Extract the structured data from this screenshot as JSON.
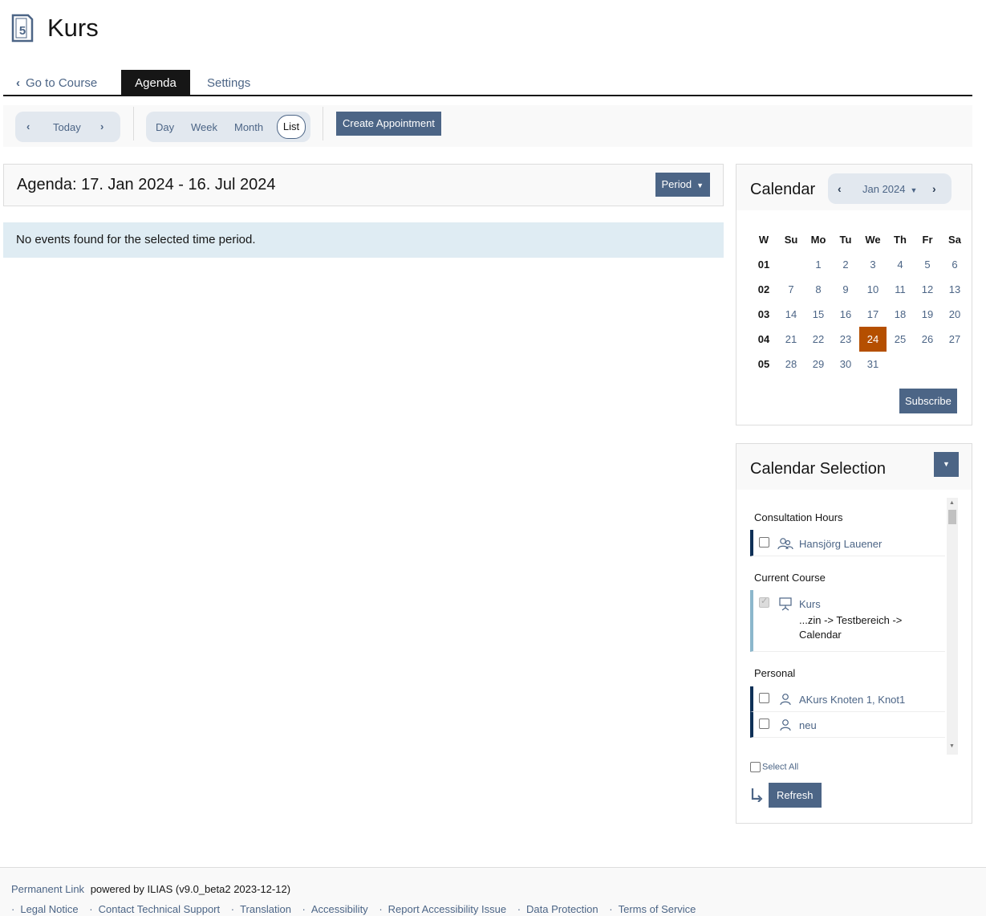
{
  "header": {
    "title": "Kurs",
    "icon_number": "5"
  },
  "tabs": {
    "back_label": "Go to Course",
    "active_label": "Agenda",
    "settings_label": "Settings"
  },
  "toolbar": {
    "today_label": "Today",
    "views": {
      "day": "Day",
      "week": "Week",
      "month": "Month",
      "list": "List"
    },
    "create_label": "Create Appointment"
  },
  "agenda": {
    "title": "Agenda: 17. Jan 2024 - 16. Jul 2024",
    "period_label": "Period",
    "empty_message": "No events found for the selected time period."
  },
  "calendar": {
    "title": "Calendar",
    "month_label": "Jan 2024",
    "day_headers": [
      "W",
      "Su",
      "Mo",
      "Tu",
      "We",
      "Th",
      "Fr",
      "Sa"
    ],
    "weeks": [
      [
        "01",
        "",
        "1",
        "2",
        "3",
        "4",
        "5",
        "6"
      ],
      [
        "02",
        "7",
        "8",
        "9",
        "10",
        "11",
        "12",
        "13"
      ],
      [
        "03",
        "14",
        "15",
        "16",
        "17",
        "18",
        "19",
        "20"
      ],
      [
        "04",
        "21",
        "22",
        "23",
        "24",
        "25",
        "26",
        "27"
      ],
      [
        "05",
        "28",
        "29",
        "30",
        "31",
        "",
        "",
        ""
      ]
    ],
    "today": "24",
    "today_color": "#b54f00",
    "subscribe_label": "Subscribe"
  },
  "selection": {
    "title": "Calendar Selection",
    "groups": {
      "consultation": {
        "title": "Consultation Hours",
        "item": "Hansjörg Lauener"
      },
      "current_course": {
        "title": "Current Course",
        "item": "Kurs",
        "path": "...zin -> Testbereich -> Calendar"
      },
      "personal": {
        "title": "Personal",
        "item1": "AKurs Knoten 1, Knot1",
        "item2": "neu"
      }
    },
    "select_all_label": "Select All",
    "refresh_label": "Refresh"
  },
  "footer": {
    "permanent_link": "Permanent Link",
    "powered_by": "powered by ILIAS (v9.0_beta2 2023-12-12)",
    "links": [
      "Legal Notice",
      "Contact Technical Support",
      "Translation",
      "Accessibility",
      "Report Accessibility Issue",
      "Data Protection",
      "Terms of Service"
    ]
  },
  "colors": {
    "accent": "#4c6586",
    "dark": "#161616",
    "info_bg": "#dfecf3"
  }
}
